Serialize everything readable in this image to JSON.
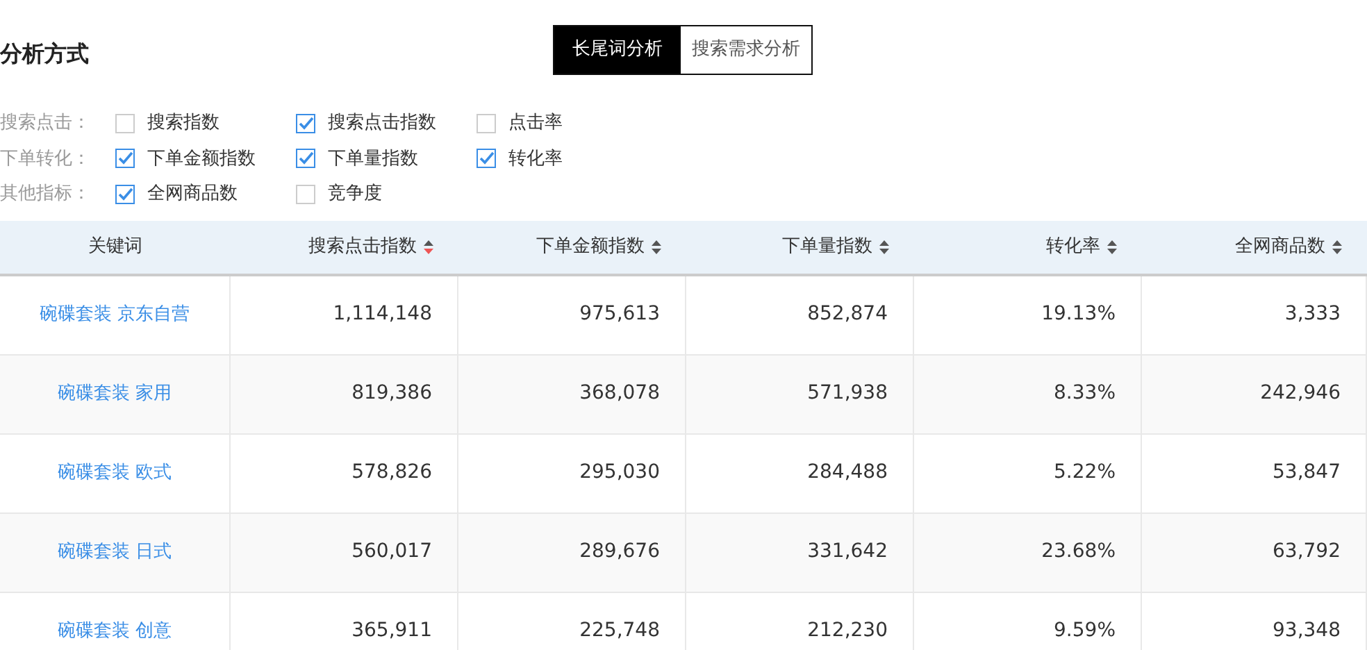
{
  "title": "分析方式",
  "modes": [
    {
      "label": "长尾词分析",
      "selected": true
    },
    {
      "label": "搜索需求分析",
      "selected": false
    }
  ],
  "filter_groups": [
    {
      "label": "搜索点击：",
      "options": [
        {
          "label": "搜索指数",
          "checked": false
        },
        {
          "label": "搜索点击指数",
          "checked": true
        },
        {
          "label": "点击率",
          "checked": false
        }
      ]
    },
    {
      "label": "下单转化：",
      "options": [
        {
          "label": "下单金额指数",
          "checked": true
        },
        {
          "label": "下单量指数",
          "checked": true
        },
        {
          "label": "转化率",
          "checked": true
        }
      ]
    },
    {
      "label": "其他指标：",
      "options": [
        {
          "label": "全网商品数",
          "checked": true
        },
        {
          "label": "竞争度",
          "checked": false
        }
      ]
    }
  ],
  "table": {
    "columns": [
      {
        "label": "关键词"
      },
      {
        "label": "搜索点击指数",
        "sorted": true
      },
      {
        "label": "下单金额指数",
        "sorted": false
      },
      {
        "label": "下单量指数",
        "sorted": false
      },
      {
        "label": "转化率",
        "sorted": false
      },
      {
        "label": "全网商品数",
        "sorted": false
      }
    ],
    "rows": [
      [
        "碗碟套装 京东自营",
        "1,114,148",
        "975,613",
        "852,874",
        "19.13%",
        "3,333"
      ],
      [
        "碗碟套装 家用",
        "819,386",
        "368,078",
        "571,938",
        "8.33%",
        "242,946"
      ],
      [
        "碗碟套装 欧式",
        "578,826",
        "295,030",
        "284,488",
        "5.22%",
        "53,847"
      ],
      [
        "碗碟套装 日式",
        "560,017",
        "289,676",
        "331,642",
        "23.68%",
        "63,792"
      ],
      [
        "碗碟套装 创意",
        "365,911",
        "225,748",
        "212,230",
        "9.59%",
        "93,348"
      ]
    ]
  }
}
